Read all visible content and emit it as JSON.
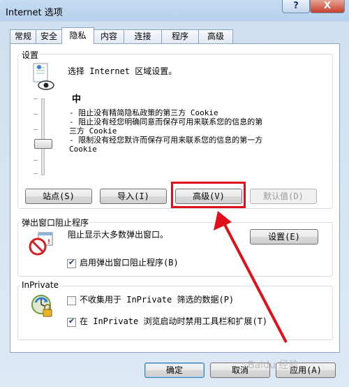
{
  "window": {
    "title": "Internet 选项",
    "help": "?",
    "close": "X"
  },
  "tabs": [
    "常规",
    "安全",
    "隐私",
    "内容",
    "连接",
    "程序",
    "高级"
  ],
  "settings": {
    "label": "设置",
    "zone_text": "选择 Internet 区域设置。",
    "level": "中",
    "desc_lines": [
      "- 阻止没有精简隐私政策的第三方 Cookie",
      "- 阻止没有经您明确同意而保存可用来联系您的信息的第",
      "三方 Cookie",
      "- 限制没有经您默许而保存可用来联系您的信息的第一方",
      "Cookie"
    ],
    "buttons": {
      "sites": "站点(S)",
      "import": "导入(I)",
      "advanced": "高级(V)",
      "default": "默认值(D)"
    }
  },
  "popup": {
    "label": "弹出窗口阻止程序",
    "text": "阻止显示大多数弹出窗口。",
    "settings_button": "设置(E)",
    "enable_label": "启用弹出窗口阻止程序(B)",
    "enable_checked": true
  },
  "inprivate": {
    "label": "InPrivate",
    "no_collect_label": "不收集用于 InPrivate 筛选的数据(P)",
    "no_collect_checked": false,
    "disable_label": "在 InPrivate 浏览启动时禁用工具栏和扩展(T)",
    "disable_checked": true
  },
  "footer": {
    "ok": "确定",
    "cancel": "取消",
    "apply": "应用(A)"
  },
  "watermark": "Baidu 经验",
  "colors": {
    "highlight": "#e0101a"
  }
}
